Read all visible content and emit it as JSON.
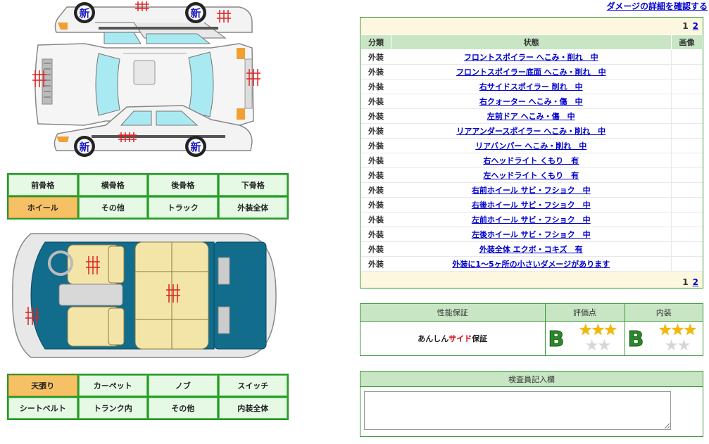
{
  "header": {
    "detail_link": "ダメージの詳細を確認する"
  },
  "exterior_diagram": {
    "new_badge": "新"
  },
  "exterior_categories": [
    {
      "label": "前骨格",
      "active": false
    },
    {
      "label": "横骨格",
      "active": false
    },
    {
      "label": "後骨格",
      "active": false
    },
    {
      "label": "下骨格",
      "active": false
    },
    {
      "label": "ホイール",
      "active": true
    },
    {
      "label": "その他",
      "active": false
    },
    {
      "label": "トラック",
      "active": false
    },
    {
      "label": "外装全体",
      "active": false
    }
  ],
  "interior_categories": [
    {
      "label": "天張り",
      "active": true
    },
    {
      "label": "カーペット",
      "active": false
    },
    {
      "label": "ノブ",
      "active": false
    },
    {
      "label": "スイッチ",
      "active": false
    },
    {
      "label": "シートベルト",
      "active": false
    },
    {
      "label": "トランク内",
      "active": false
    },
    {
      "label": "その他",
      "active": false
    },
    {
      "label": "内装全体",
      "active": false
    }
  ],
  "damage_table": {
    "pager": {
      "current": "1",
      "next": "2"
    },
    "headers": {
      "category": "分類",
      "condition": "状態",
      "image": "画像"
    },
    "rows": [
      {
        "category": "外装",
        "condition": "フロントスポイラー へこみ・削れ　中"
      },
      {
        "category": "外装",
        "condition": "フロントスポイラー底面 へこみ・削れ　中"
      },
      {
        "category": "外装",
        "condition": "右サイドスポイラー 削れ　中"
      },
      {
        "category": "外装",
        "condition": "右クォーター へこみ・傷　中"
      },
      {
        "category": "外装",
        "condition": "左前ドア へこみ・傷　中"
      },
      {
        "category": "外装",
        "condition": "リアアンダースポイラー へこみ・削れ　中"
      },
      {
        "category": "外装",
        "condition": "リアバンパー へこみ・削れ　中"
      },
      {
        "category": "外装",
        "condition": "右ヘッドライト くもり　有"
      },
      {
        "category": "外装",
        "condition": "左ヘッドライト くもり　有"
      },
      {
        "category": "外装",
        "condition": "右前ホイール サビ・フショク　中"
      },
      {
        "category": "外装",
        "condition": "右後ホイール サビ・フショク　中"
      },
      {
        "category": "外装",
        "condition": "左前ホイール サビ・フショク　中"
      },
      {
        "category": "外装",
        "condition": "左後ホイール サビ・フショク　中"
      },
      {
        "category": "外装",
        "condition": "外装全体 エクボ・コキズ　有"
      },
      {
        "category": "外装",
        "condition": "外装に1〜5ヶ所の小さいダメージがあります"
      }
    ]
  },
  "warranty": {
    "headers": {
      "performance": "性能保証",
      "score": "評価点",
      "interior": "内装"
    },
    "name_prefix": "あんしん",
    "name_accent": "サイド",
    "name_suffix": "保証",
    "accent_color": "#d00000",
    "score": {
      "grade": "B",
      "stars": 3,
      "max_stars": 5
    },
    "interior": {
      "grade": "B",
      "stars": 3,
      "max_stars": 5
    }
  },
  "inspector": {
    "title": "検査員記入欄",
    "value": ""
  },
  "colors": {
    "panel_border": "#3a9a3a",
    "header_bg": "#c8e6c4",
    "active_tab": "#f6c165",
    "tab_bg": "#e5f9e5",
    "link": "#0000cc",
    "damage_mark": "#e02020"
  }
}
